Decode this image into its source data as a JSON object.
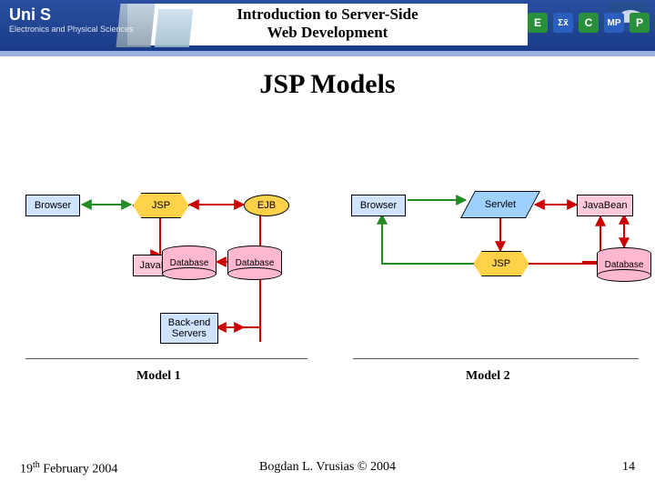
{
  "header": {
    "course_title_line1": "Introduction to Server-Side",
    "course_title_line2": "Web Development",
    "uni_logo_main": "Uni S",
    "uni_logo_sub": "Electronics and Physical Sciences",
    "badge1": "E",
    "badge2": "C",
    "badge3": "MP",
    "badge4": "P",
    "sigma": "Σx̄"
  },
  "page_title": "JSP Models",
  "models": {
    "model1": {
      "caption": "Model 1",
      "nodes": {
        "browser": "Browser",
        "jsp": "JSP",
        "ejb": "EJB",
        "javabean": "JavaBean",
        "database": "Database",
        "backend": "Back-end\nServers"
      }
    },
    "model2": {
      "caption": "Model 2",
      "nodes": {
        "browser": "Browser",
        "servlet": "Servlet",
        "javabean": "JavaBean",
        "jsp": "JSP",
        "database": "Database"
      }
    }
  },
  "footer": {
    "date_prefix": "19",
    "date_sup": "th",
    "date_suffix": " February 2004",
    "author": "Bogdan L. Vrusias © 2004",
    "page": "14"
  },
  "chart_data": [
    {
      "type": "flowchart",
      "title": "Model 1",
      "nodes": [
        {
          "id": "browser",
          "label": "Browser",
          "shape": "rect",
          "fill": "lightblue"
        },
        {
          "id": "jsp",
          "label": "JSP",
          "shape": "hexagon",
          "fill": "gold"
        },
        {
          "id": "ejb",
          "label": "EJB",
          "shape": "ellipse",
          "fill": "gold"
        },
        {
          "id": "javabean",
          "label": "JavaBean",
          "shape": "rect",
          "fill": "pink"
        },
        {
          "id": "database",
          "label": "Database",
          "shape": "cylinder",
          "fill": "pink"
        },
        {
          "id": "backend",
          "label": "Back-end Servers",
          "shape": "rect",
          "fill": "lightblue"
        }
      ],
      "edges": [
        {
          "from": "browser",
          "to": "jsp",
          "dir": "both",
          "color": "green"
        },
        {
          "from": "jsp",
          "to": "ejb",
          "dir": "both",
          "color": "red"
        },
        {
          "from": "jsp",
          "to": "javabean",
          "dir": "forward",
          "color": "red"
        },
        {
          "from": "ejb",
          "to": "database",
          "dir": "both",
          "color": "red"
        },
        {
          "from": "ejb",
          "to": "backend",
          "dir": "both",
          "color": "red"
        }
      ]
    },
    {
      "type": "flowchart",
      "title": "Model 2",
      "nodes": [
        {
          "id": "browser",
          "label": "Browser",
          "shape": "rect",
          "fill": "lightblue"
        },
        {
          "id": "servlet",
          "label": "Servlet",
          "shape": "parallelogram",
          "fill": "lightblue"
        },
        {
          "id": "javabean",
          "label": "JavaBean",
          "shape": "rect",
          "fill": "pink"
        },
        {
          "id": "jsp",
          "label": "JSP",
          "shape": "hexagon",
          "fill": "gold"
        },
        {
          "id": "database",
          "label": "Database",
          "shape": "cylinder",
          "fill": "pink"
        }
      ],
      "edges": [
        {
          "from": "browser",
          "to": "servlet",
          "dir": "forward",
          "color": "green"
        },
        {
          "from": "servlet",
          "to": "javabean",
          "dir": "both",
          "color": "red"
        },
        {
          "from": "servlet",
          "to": "jsp",
          "dir": "forward",
          "color": "red"
        },
        {
          "from": "jsp",
          "to": "browser",
          "dir": "forward",
          "color": "green"
        },
        {
          "from": "jsp",
          "to": "javabean",
          "dir": "forward",
          "color": "red"
        },
        {
          "from": "javabean",
          "to": "database",
          "dir": "both",
          "color": "red"
        }
      ]
    }
  ]
}
